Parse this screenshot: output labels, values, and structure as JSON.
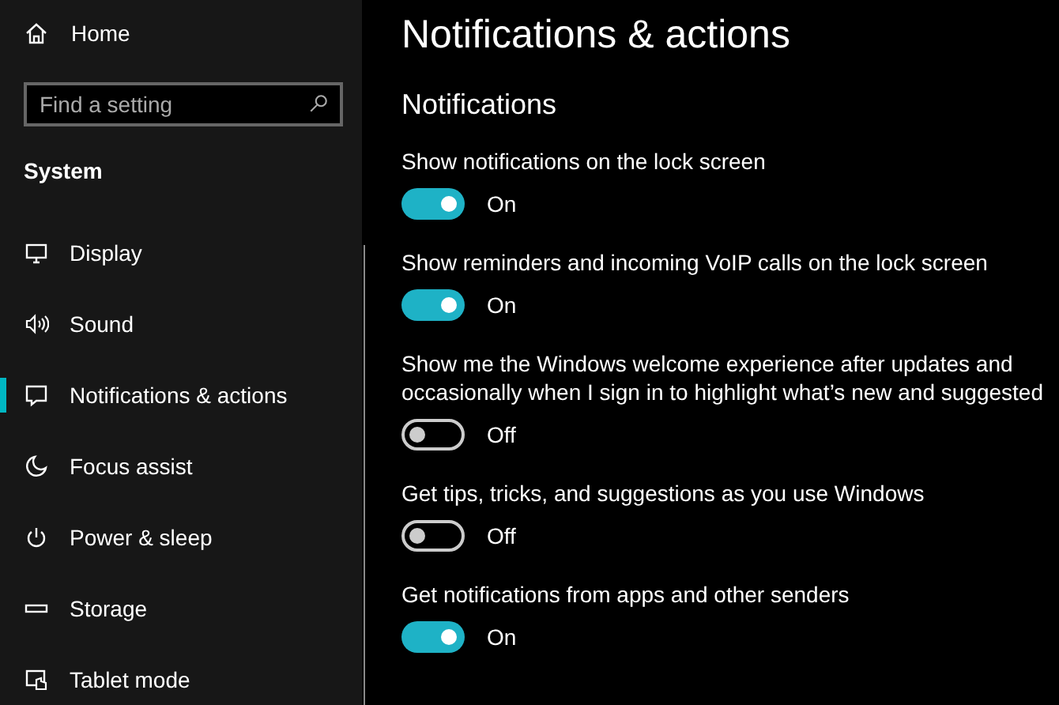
{
  "sidebar": {
    "home": "Home",
    "search": {
      "placeholder": "Find a setting"
    },
    "section": "System",
    "items": [
      {
        "label": "Display",
        "selected": false
      },
      {
        "label": "Sound",
        "selected": false
      },
      {
        "label": "Notifications & actions",
        "selected": true
      },
      {
        "label": "Focus assist",
        "selected": false
      },
      {
        "label": "Power & sleep",
        "selected": false
      },
      {
        "label": "Storage",
        "selected": false
      },
      {
        "label": "Tablet mode",
        "selected": false
      }
    ]
  },
  "page": {
    "title": "Notifications & actions",
    "section": "Notifications",
    "settings": [
      {
        "label": "Show notifications on the lock screen",
        "on": true,
        "state": "On"
      },
      {
        "label": "Show reminders and incoming VoIP calls on the lock screen",
        "on": true,
        "state": "On"
      },
      {
        "label": "Show me the Windows welcome experience after updates and occasionally when I sign in to highlight what’s new and suggested",
        "on": false,
        "state": "Off"
      },
      {
        "label": "Get tips, tricks, and suggestions as you use Windows",
        "on": false,
        "state": "Off"
      },
      {
        "label": "Get notifications from apps and other senders",
        "on": true,
        "state": "On"
      }
    ]
  }
}
